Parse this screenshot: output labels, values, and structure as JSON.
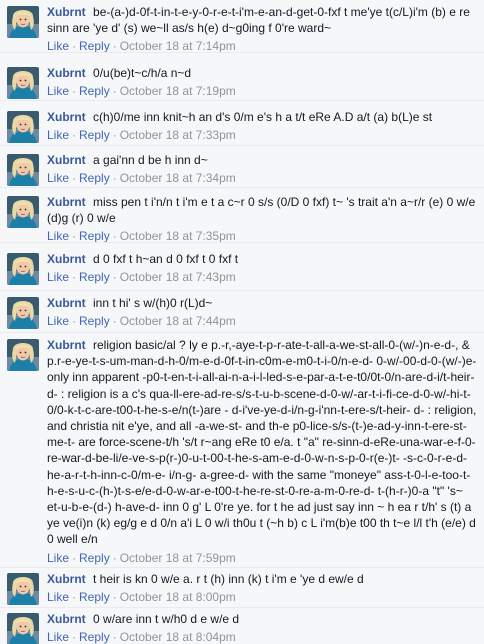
{
  "actions": {
    "like": "Like",
    "reply": "Reply",
    "separator": "·"
  },
  "comments": [
    {
      "author": "Xubrnt",
      "text": "be-(a-)d-0f-t-in-t-e-y-0-r-e-t-i'm-e-an-d-get-0-fxf t me'ye t(c/L)i'm (b) e re sinn are 'ye d' (s) we~ll as/s h(e) d~g0ing f 0're ward~",
      "time": "October 18 at 7:14pm"
    },
    {
      "author": "Xubrnt",
      "text": "0/u(be)t~c/h/a n~d",
      "time": "October 18 at 7:19pm"
    },
    {
      "author": "Xubrnt",
      "text": "c(h)0/me inn knit~h an d's 0/m e's h a t/t eRe A.D a/t (a) b(L)e st",
      "time": "October 18 at 7:33pm"
    },
    {
      "author": "Xubrnt",
      "text": "a gai'nn d be h inn d~",
      "time": "October 18 at 7:34pm"
    },
    {
      "author": "Xubrnt",
      "text": "miss pen t i'n/n t i'm e t a c~r 0 s/s (0/D 0 fxf) t~ 's trait a'n a~r/r (e) 0 w/e (d)g (r) 0 w/e",
      "time": "October 18 at 7:35pm"
    },
    {
      "author": "Xubrnt",
      "text": "d 0 fxf t h~an d 0 fxf t 0 fxf t",
      "time": "October 18 at 7:43pm"
    },
    {
      "author": "Xubrnt",
      "text": "inn t hi' s w/(h)0 r(L)d~",
      "time": "October 18 at 7:44pm"
    },
    {
      "author": "Xubrnt",
      "text": "religion basic/al ? ly e p.-r,-aye-t-p-r-ate-t-all-a-we-st-all-0-(w/-)n-e-d-, & p.r-e-ye-t-s-um-man-d-h-0/m-e-d-0f-t-in-c0m-e-m0-t-i-0/n-e-d- 0-w/-00-d-0-(w/-)e- only inn apparent -p0-t-en-t-i-all-ai-n-a-i-l-led-s-e-par-a-t-e-t0/0t-0/n-are-d-i/t-heir-d- : religion is a c's qua-ll-ere-ad-re-s/s-t-u-b-scene-d-0-w/-ar-t-i-fi-ce-d-0-w/-hi-t-0/0-k-t-c-are-t00-t-he-s-e/n(t-)are - d-i've-ye-d-i/n-g-i'nn-t-ere-s/t-heir- d- : religion, and christia nit e'ye, and all -a-we-st- and th-e p0-lice-s/s-(t-)e-ad-y-inn-t-ere-st-me-t- are force-scene-t/h 's/t r~ang eRe t0 e/a. t \"a\" re-sinn-d-eRe-una-war-e-f-0-re-war-d-be-li/e-ve-s-p(r-)0-u-t-00-t-he-s-am-e-d-0-w-n-s-p-0-r(e-)t- -s-c-0-r-e-d-he-a-r-t-h-inn-c-0/m-e- i/n-g- a-gree-d- with the same \"moneye\" ass-t-0-l-e-too-t-h-e-s-u-c-(h-)t-s-e/e-d-0-w-ar-e-t00-t-he-re-st-0-re-a-m-0-re-d- t-(h-r-)0-a \"t\" 's~ et-u-b-e-(d-) h-ave-d- inn 0 g' L 0're ye. for t he ad just say inn ~ h ea r t/h' s (t) a ye ve(i)n (k) eg/g e d 0/n a'i L 0 w/i th0u t (~h b) c L i'm(b)e t00 th t~e l/l t'h (e/e) d 0 well e/n",
      "time": "October 18 at 7:59pm"
    },
    {
      "author": "Xubrnt",
      "text": "t heir is kn 0 w/e a. r t (h) inn (k) t i'm e 'ye d ew/e d",
      "time": "October 18 at 8:00pm"
    },
    {
      "author": "Xubrnt",
      "text": "0 w/are inn t w/h0 d e w/e d",
      "time": "October 18 at 8:04pm"
    }
  ]
}
